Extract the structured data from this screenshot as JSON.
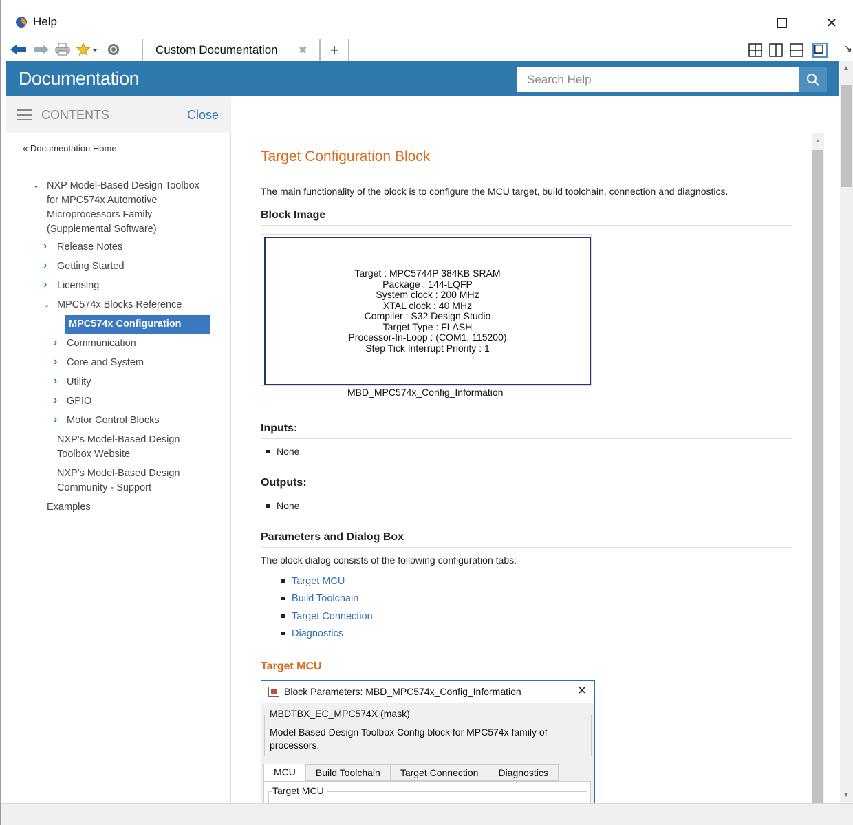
{
  "window": {
    "title": "Help",
    "minimize_icon": "minimize-icon",
    "maximize_icon": "maximize-icon",
    "close_glyph": "✕"
  },
  "toolbar": {
    "tab_label": "Custom Documentation",
    "tab_close": "✖",
    "new_tab": "+",
    "more": "↘"
  },
  "header": {
    "title": "Documentation",
    "search_placeholder": "Search Help"
  },
  "sidebar": {
    "contents_label": "CONTENTS",
    "close_label": "Close",
    "home_link": "« Documentation Home",
    "items": [
      {
        "label": "NXP Model-Based Design Toolbox for MPC574x Automotive Microprocessors Family (Supplemental Software)",
        "chev": "⌄"
      },
      {
        "label": "Release Notes",
        "chev": "›"
      },
      {
        "label": "Getting Started",
        "chev": "›"
      },
      {
        "label": "Licensing",
        "chev": "›"
      },
      {
        "label": "MPC574x Blocks Reference",
        "chev": "⌄"
      },
      {
        "label": "MPC574x Configuration",
        "chev": ""
      },
      {
        "label": "Communication",
        "chev": "›"
      },
      {
        "label": "Core and System",
        "chev": "›"
      },
      {
        "label": "Utility",
        "chev": "›"
      },
      {
        "label": "GPIO",
        "chev": "›"
      },
      {
        "label": "Motor Control Blocks",
        "chev": "›"
      },
      {
        "label": "NXP's Model-Based Design Toolbox Website",
        "chev": ""
      },
      {
        "label": "NXP's Model-Based Design Community - Support",
        "chev": ""
      },
      {
        "label": "Examples",
        "chev": ""
      }
    ]
  },
  "content": {
    "title": "Target Configuration Block",
    "intro": "The main functionality of the block is to configure the MCU target, build toolchain, connection and diagnostics.",
    "block_image_heading": "Block Image",
    "block_lines": [
      "Target : MPC5744P 384KB SRAM",
      "Package : 144-LQFP",
      "System clock : 200 MHz",
      "XTAL clock : 40 MHz",
      "Compiler : S32 Design Studio",
      "Target Type : FLASH",
      "Processor-In-Loop : (COM1, 115200)",
      "Step Tick Interrupt Priority : 1"
    ],
    "block_caption": "MBD_MPC574x_Config_Information",
    "inputs_heading": "Inputs:",
    "inputs_value": "None",
    "outputs_heading": "Outputs:",
    "outputs_value": "None",
    "params_heading": "Parameters and Dialog Box",
    "params_intro": "The block dialog consists of the following configuration tabs:",
    "param_links": [
      "Target MCU",
      "Build Toolchain",
      "Target Connection",
      "Diagnostics"
    ],
    "target_mcu_heading": "Target MCU",
    "dialog": {
      "title": "Block Parameters: MBD_MPC574x_Config_Information",
      "close": "✕",
      "mask": "MBDTBX_EC_MPC574X (mask)",
      "description": "Model Based Design Toolbox Config block for MPC574x family of processors.",
      "tabs": [
        "MCU",
        "Build Toolchain",
        "Target Connection",
        "Diagnostics"
      ],
      "group": "Target MCU"
    }
  }
}
